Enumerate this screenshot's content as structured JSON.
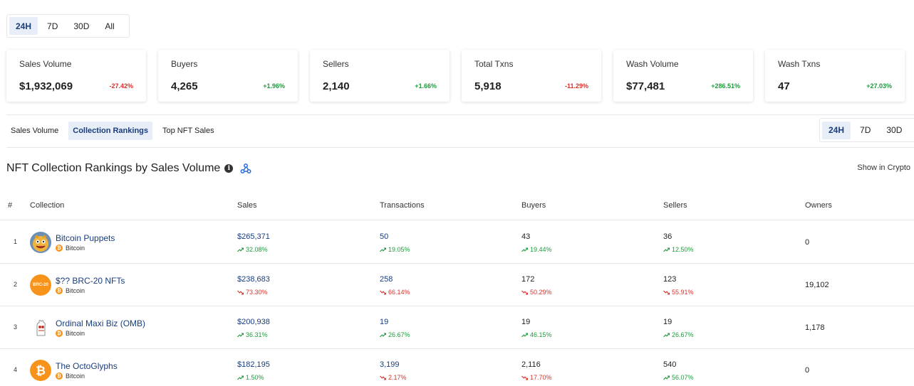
{
  "period_selector_top": {
    "options": [
      "24H",
      "7D",
      "30D",
      "All"
    ],
    "active": "24H"
  },
  "stats": [
    {
      "label": "Sales Volume",
      "value": "$1,932,069",
      "change": "-27.42%",
      "direction": "down"
    },
    {
      "label": "Buyers",
      "value": "4,265",
      "change": "+1.96%",
      "direction": "up"
    },
    {
      "label": "Sellers",
      "value": "2,140",
      "change": "+1.66%",
      "direction": "up"
    },
    {
      "label": "Total Txns",
      "value": "5,918",
      "change": "-11.29%",
      "direction": "down"
    },
    {
      "label": "Wash Volume",
      "value": "$77,481",
      "change": "+286.51%",
      "direction": "up"
    },
    {
      "label": "Wash Txns",
      "value": "47",
      "change": "+27.03%",
      "direction": "up"
    }
  ],
  "tabs": {
    "items": [
      "Sales Volume",
      "Collection Rankings",
      "Top NFT Sales"
    ],
    "active": "Collection Rankings"
  },
  "period_selector_right": {
    "options": [
      "24H",
      "7D",
      "30D"
    ],
    "active": "24H"
  },
  "section": {
    "title": "NFT Collection Rankings by Sales Volume",
    "info_icon": "info-icon",
    "webhook_icon": "webhook-icon",
    "crypto_toggle_label": "Show in Crypto"
  },
  "table": {
    "headers": [
      "#",
      "Collection",
      "Sales",
      "Transactions",
      "Buyers",
      "Sellers",
      "Owners"
    ],
    "rows": [
      {
        "rank": "1",
        "name": "Bitcoin Puppets",
        "chain": "Bitcoin",
        "avatar": "puppet",
        "sales": "$265,371",
        "sales_chg": "32.08%",
        "sales_dir": "up",
        "txns": "50",
        "txns_chg": "19.05%",
        "txns_dir": "up",
        "buyers": "43",
        "buyers_chg": "19.44%",
        "buyers_dir": "up",
        "sellers": "36",
        "sellers_chg": "12.50%",
        "sellers_dir": "up",
        "owners": "0"
      },
      {
        "rank": "2",
        "name": "$?? BRC-20 NFTs",
        "chain": "Bitcoin",
        "avatar": "brc20",
        "avatar_text": "BRC-20",
        "sales": "$238,683",
        "sales_chg": "73.30%",
        "sales_dir": "down",
        "txns": "258",
        "txns_chg": "66.14%",
        "txns_dir": "down",
        "buyers": "172",
        "buyers_chg": "50.29%",
        "buyers_dir": "down",
        "sellers": "123",
        "sellers_chg": "55.91%",
        "sellers_dir": "down",
        "owners": "19,102"
      },
      {
        "rank": "3",
        "name": "Ordinal Maxi Biz (OMB)",
        "chain": "Bitcoin",
        "avatar": "omb",
        "sales": "$200,938",
        "sales_chg": "36.31%",
        "sales_dir": "up",
        "txns": "19",
        "txns_chg": "26.67%",
        "txns_dir": "up",
        "buyers": "19",
        "buyers_chg": "46.15%",
        "buyers_dir": "up",
        "sellers": "19",
        "sellers_chg": "26.67%",
        "sellers_dir": "up",
        "owners": "1,178"
      },
      {
        "rank": "4",
        "name": "The OctoGlyphs",
        "chain": "Bitcoin",
        "avatar": "btc",
        "sales": "$182,195",
        "sales_chg": "1.50%",
        "sales_dir": "up",
        "txns": "3,199",
        "txns_chg": "2.17%",
        "txns_dir": "down",
        "buyers": "2,116",
        "buyers_chg": "17.70%",
        "buyers_dir": "down",
        "sellers": "540",
        "sellers_chg": "56.07%",
        "sellers_dir": "up",
        "owners": "0"
      }
    ]
  },
  "colors": {
    "accent": "#1a3d7c",
    "active_bg": "#e8eef8",
    "positive": "#1e9b3c",
    "negative": "#d9312b",
    "bitcoin": "#f7931a"
  }
}
